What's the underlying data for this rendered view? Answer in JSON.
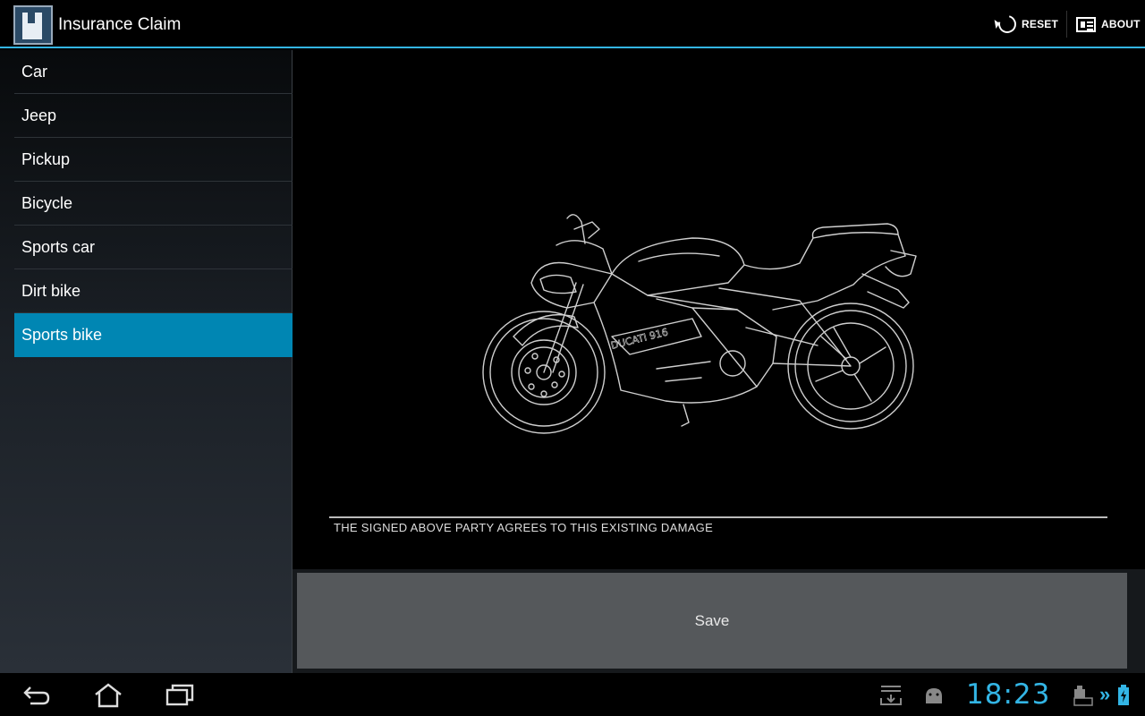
{
  "action_bar": {
    "title": "Insurance Claim",
    "reset_label": "RESET",
    "about_label": "ABOUT",
    "accent_color": "#33b5e5"
  },
  "sidebar": {
    "items": [
      {
        "label": "Car"
      },
      {
        "label": "Jeep"
      },
      {
        "label": "Pickup"
      },
      {
        "label": "Bicycle"
      },
      {
        "label": "Sports car"
      },
      {
        "label": "Dirt bike"
      },
      {
        "label": "Sports bike"
      }
    ],
    "selected_index": 6,
    "selected_color": "#0086b3"
  },
  "canvas": {
    "image": "motorcycle-line-drawing",
    "disclaimer": "THE SIGNED ABOVE PARTY AGREES TO THIS EXISTING DAMAGE"
  },
  "save_label": "Save",
  "system_bar": {
    "time": "18:23",
    "icons": [
      "back-icon",
      "home-icon",
      "recent-apps-icon",
      "download-icon",
      "android-debug-icon",
      "keyboard-battery-icon",
      "battery-charging-icon"
    ]
  }
}
